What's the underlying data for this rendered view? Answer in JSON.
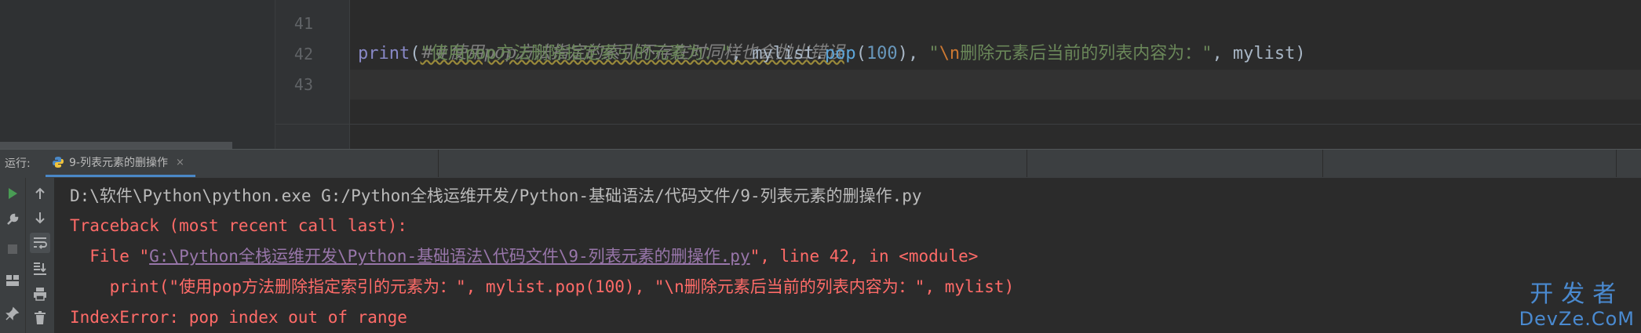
{
  "editor": {
    "line_numbers": [
      "41",
      "42",
      "43"
    ],
    "lines": {
      "l41": {
        "comment": "##使用pop方法指定的索引不存在时同样也会抛出错误"
      },
      "l42": {
        "func": "print",
        "open": "(",
        "str1": "\"使用pop方法删除指定索引的元素为：\"",
        "sep1": ", mylist.",
        "meth": "pop",
        "paren_open": "(",
        "num": "100",
        "paren_close": ")",
        "sep2": ", ",
        "str2_quote": "\"",
        "escape": "\\n",
        "str2_rest": "删除元素后当前的列表内容为：\"",
        "sep3": ", mylist)"
      }
    }
  },
  "run_panel": {
    "label": "运行:",
    "tab_title": "9-列表元素的删操作",
    "tab_close": "×"
  },
  "console": {
    "cmd_line": "D:\\软件\\Python\\python.exe G:/Python全栈运维开发/Python-基础语法/代码文件/9-列表元素的删操作.py",
    "traceback_header": "Traceback (most recent call last):",
    "file_prefix": "  File \"",
    "file_link": "G:\\Python全栈运维开发\\Python-基础语法\\代码文件\\9-列表元素的删操作.py",
    "file_suffix": "\", line 42, in <module>",
    "code_line": "    print(\"使用pop方法删除指定索引的元素为：\", mylist.pop(100), \"\\n删除元素后当前的列表内容为：\", mylist)",
    "error_line": "IndexError: pop index out of range"
  },
  "watermark": {
    "top": "开发者",
    "bottom": "DevZe.CoM"
  },
  "colors": {
    "error": "#ff6b68",
    "link": "#287bde",
    "string": "#6a8759",
    "number": "#6897bb",
    "accent_tab": "#4a88c7"
  },
  "icons": [
    "run-icon",
    "wrench-icon",
    "stop-icon",
    "layout-icon",
    "pin-icon",
    "arrow-up-icon",
    "arrow-down-icon",
    "soft-wrap-icon",
    "scroll-to-end-icon",
    "print-icon",
    "trash-icon",
    "python-icon",
    "close-icon"
  ]
}
